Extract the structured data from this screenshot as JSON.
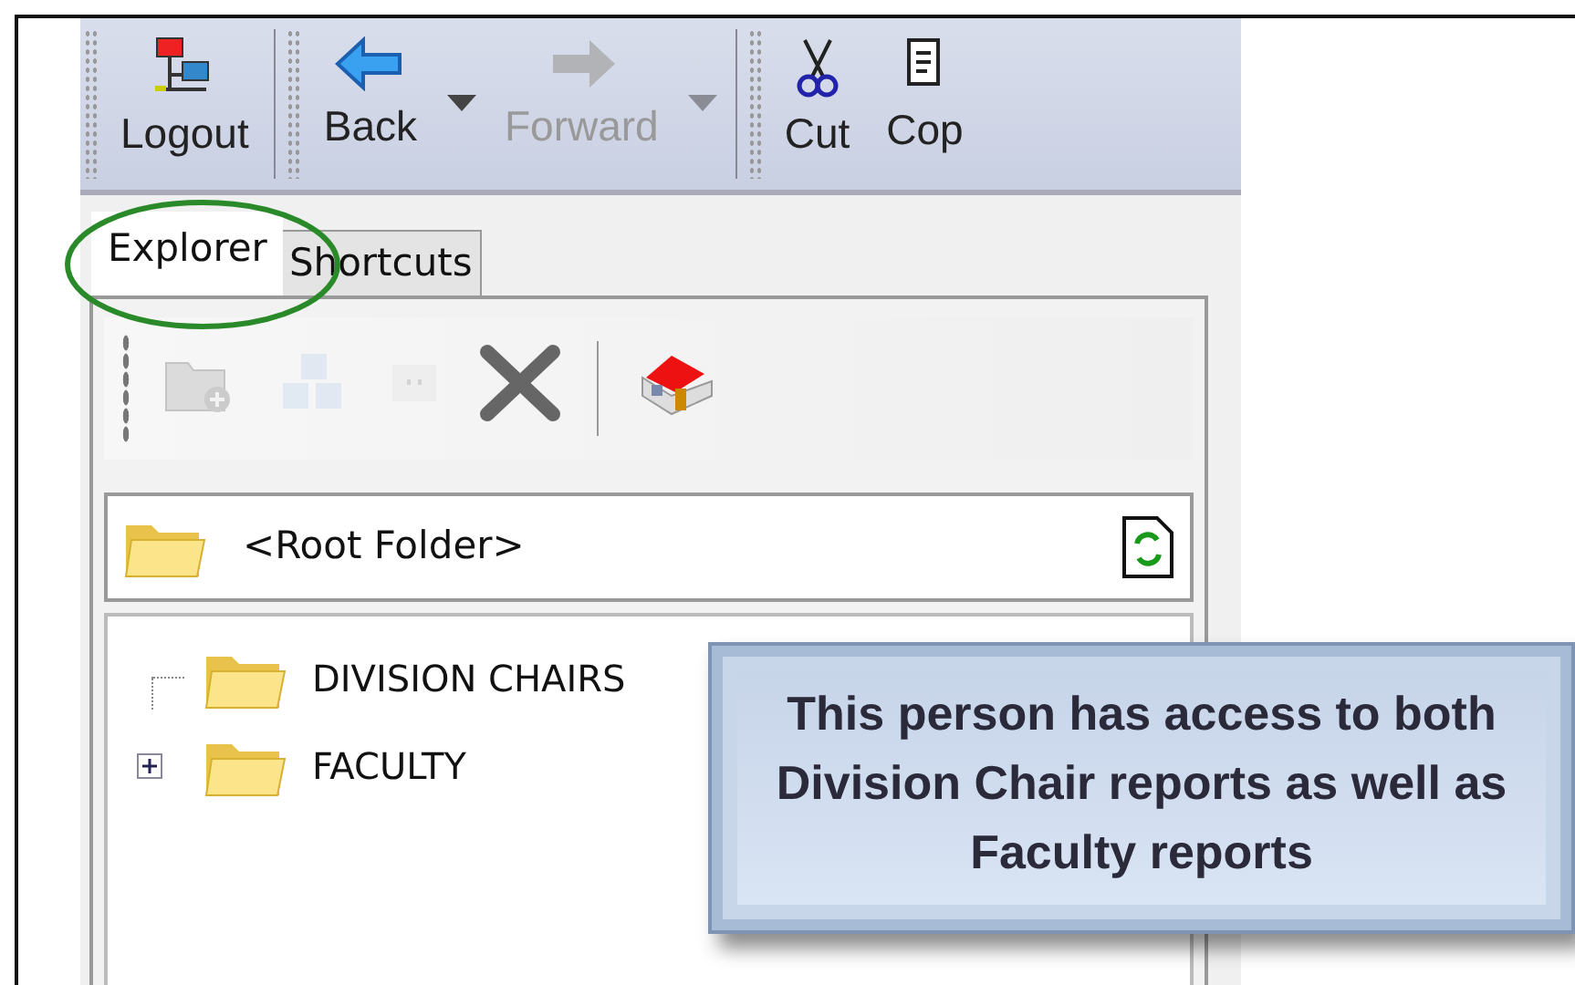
{
  "toolbar": [
    {
      "kind": "logout",
      "label": "Logout",
      "disabled": false
    },
    {
      "kind": "separator"
    },
    {
      "kind": "back",
      "label": "Back",
      "disabled": false
    },
    {
      "kind": "dropdown",
      "disabled": false
    },
    {
      "kind": "forward",
      "label": "Forward",
      "disabled": true
    },
    {
      "kind": "dropdown",
      "disabled": true
    },
    {
      "kind": "separator"
    },
    {
      "kind": "cut",
      "label": "Cut",
      "disabled": false
    },
    {
      "kind": "copy",
      "label": "Cop",
      "disabled": false
    }
  ],
  "tabs": [
    {
      "label": "Explorer",
      "selected": true
    },
    {
      "label": "Shortcuts",
      "selected": false
    }
  ],
  "panel_toolbar": [
    {
      "kind": "new-folder",
      "disabled": true
    },
    {
      "kind": "share",
      "disabled": true
    },
    {
      "kind": "rename",
      "disabled": true
    },
    {
      "kind": "delete",
      "disabled": false
    },
    {
      "kind": "home",
      "disabled": false
    }
  ],
  "root_folder": {
    "label": "<Root Folder>"
  },
  "tree": [
    {
      "label": "DIVISION CHAIRS",
      "expandable": false
    },
    {
      "label": "FACULTY",
      "expandable": true
    }
  ],
  "callout": {
    "text": "This person has access to both Division Chair reports as well as Faculty reports"
  }
}
